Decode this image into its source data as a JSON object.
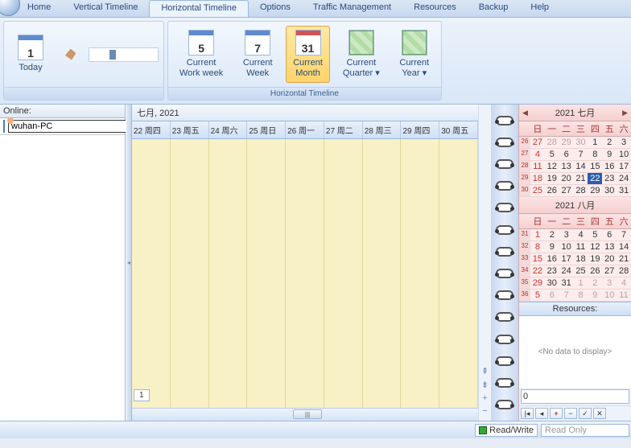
{
  "tabs": [
    "Home",
    "Vertical Timeline",
    "Horizontal Timeline",
    "Options",
    "Traffic Management",
    "Resources",
    "Backup",
    "Help"
  ],
  "active_tab": 2,
  "ribbon": {
    "today": "Today",
    "group2_label": "Horizontal Timeline",
    "btns": [
      {
        "num": "5",
        "label": "Current\nWork week"
      },
      {
        "num": "7",
        "label": "Current\nWeek"
      },
      {
        "num": "31",
        "label": "Current\nMonth"
      },
      {
        "num": "",
        "label": "Current\nQuarter ▾"
      },
      {
        "num": "",
        "label": "Current\nYear ▾"
      }
    ]
  },
  "online": {
    "header": "Online:",
    "user": "wuhan-PC"
  },
  "timeline": {
    "title": "七月, 2021",
    "cols": [
      "22 周四",
      "23 周五",
      "24 周六",
      "25 周日",
      "26 周一",
      "27 周二",
      "28 周三",
      "29 周四",
      "30 周五"
    ]
  },
  "cal1": {
    "title": "2021 七月",
    "dow": [
      "日",
      "一",
      "二",
      "三",
      "四",
      "五",
      "六"
    ],
    "weeks": [
      {
        "wk": "26",
        "d": [
          {
            "v": "27",
            "o": 1,
            "s": 1
          },
          {
            "v": "28",
            "o": 1
          },
          {
            "v": "29",
            "o": 1
          },
          {
            "v": "30",
            "o": 1
          },
          {
            "v": "1"
          },
          {
            "v": "2"
          },
          {
            "v": "3"
          }
        ]
      },
      {
        "wk": "27",
        "d": [
          {
            "v": "4",
            "s": 1
          },
          {
            "v": "5"
          },
          {
            "v": "6"
          },
          {
            "v": "7"
          },
          {
            "v": "8"
          },
          {
            "v": "9"
          },
          {
            "v": "10"
          }
        ]
      },
      {
        "wk": "28",
        "d": [
          {
            "v": "11",
            "s": 1
          },
          {
            "v": "12"
          },
          {
            "v": "13"
          },
          {
            "v": "14"
          },
          {
            "v": "15"
          },
          {
            "v": "16"
          },
          {
            "v": "17"
          }
        ]
      },
      {
        "wk": "29",
        "d": [
          {
            "v": "18",
            "s": 1
          },
          {
            "v": "19"
          },
          {
            "v": "20"
          },
          {
            "v": "21"
          },
          {
            "v": "22",
            "t": 1
          },
          {
            "v": "23"
          },
          {
            "v": "24"
          }
        ]
      },
      {
        "wk": "30",
        "d": [
          {
            "v": "25",
            "s": 1
          },
          {
            "v": "26"
          },
          {
            "v": "27"
          },
          {
            "v": "28"
          },
          {
            "v": "29"
          },
          {
            "v": "30"
          },
          {
            "v": "31"
          }
        ]
      }
    ]
  },
  "cal2": {
    "title": "2021 八月",
    "dow": [
      "日",
      "一",
      "二",
      "三",
      "四",
      "五",
      "六"
    ],
    "weeks": [
      {
        "wk": "31",
        "d": [
          {
            "v": "1",
            "s": 1
          },
          {
            "v": "2"
          },
          {
            "v": "3"
          },
          {
            "v": "4"
          },
          {
            "v": "5"
          },
          {
            "v": "6"
          },
          {
            "v": "7"
          }
        ]
      },
      {
        "wk": "32",
        "d": [
          {
            "v": "8",
            "s": 1
          },
          {
            "v": "9"
          },
          {
            "v": "10"
          },
          {
            "v": "11"
          },
          {
            "v": "12"
          },
          {
            "v": "13"
          },
          {
            "v": "14"
          }
        ]
      },
      {
        "wk": "33",
        "d": [
          {
            "v": "15",
            "s": 1
          },
          {
            "v": "16"
          },
          {
            "v": "17"
          },
          {
            "v": "18"
          },
          {
            "v": "19"
          },
          {
            "v": "20"
          },
          {
            "v": "21"
          }
        ]
      },
      {
        "wk": "34",
        "d": [
          {
            "v": "22",
            "s": 1
          },
          {
            "v": "23"
          },
          {
            "v": "24"
          },
          {
            "v": "25"
          },
          {
            "v": "26"
          },
          {
            "v": "27"
          },
          {
            "v": "28"
          }
        ]
      },
      {
        "wk": "35",
        "d": [
          {
            "v": "29",
            "s": 1
          },
          {
            "v": "30"
          },
          {
            "v": "31"
          },
          {
            "v": "1",
            "o": 1
          },
          {
            "v": "2",
            "o": 1
          },
          {
            "v": "3",
            "o": 1
          },
          {
            "v": "4",
            "o": 1
          }
        ]
      },
      {
        "wk": "36",
        "d": [
          {
            "v": "5",
            "o": 1,
            "s": 1
          },
          {
            "v": "6",
            "o": 1
          },
          {
            "v": "7",
            "o": 1
          },
          {
            "v": "8",
            "o": 1
          },
          {
            "v": "9",
            "o": 1
          },
          {
            "v": "10",
            "o": 1
          },
          {
            "v": "11",
            "o": 1
          }
        ]
      }
    ]
  },
  "resources": {
    "header": "Resources:",
    "empty": "<No data to display>",
    "value": "0"
  },
  "status": {
    "rw": "Read/Write",
    "ro": "Read Only",
    "page": "1"
  }
}
